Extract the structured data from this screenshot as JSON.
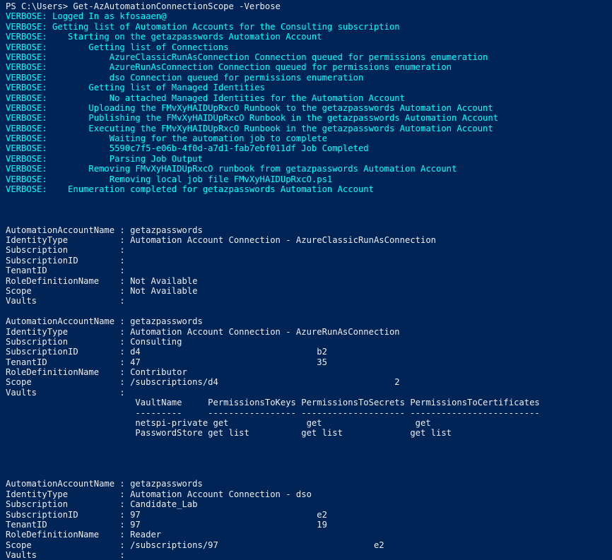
{
  "colors": {
    "background": "#012456",
    "text": "#eeedf0",
    "verbose": "#00ffff"
  },
  "prompt": "PS C:\\Users> Get-AzAutomationConnectionScope -Verbose",
  "verbose_lines": [
    "VERBOSE: Logged In as kfosaaen@",
    "VERBOSE: Getting list of Automation Accounts for the Consulting subscription",
    "VERBOSE:    Starting on the getazpasswords Automation Account",
    "VERBOSE:        Getting list of Connections",
    "VERBOSE:            AzureClassicRunAsConnection Connection queued for permissions enumeration",
    "VERBOSE:            AzureRunAsConnection Connection queued for permissions enumeration",
    "VERBOSE:            dso Connection queued for permissions enumeration",
    "VERBOSE:        Getting list of Managed Identities",
    "VERBOSE:            No attached Managed Identities for the Automation Account",
    "VERBOSE:        Uploading the FMvXyHAIDUpRxcO Runbook to the getazpasswords Automation Account",
    "VERBOSE:        Publishing the FMvXyHAIDUpRxcO Runbook in the getazpasswords Automation Account",
    "VERBOSE:        Executing the FMvXyHAIDUpRxcO Runbook in the getazpasswords Automation Account",
    "VERBOSE:            Waiting for the automation job to complete",
    "VERBOSE:            5590c7f5-e06b-4f0d-a7d1-fab7ebf011df Job Completed",
    "VERBOSE:            Parsing Job Output",
    "VERBOSE:        Removing FMvXyHAIDUpRxcO runbook from getazpasswords Automation Account",
    "VERBOSE:            Removing local job file FMvXyHAIDUpRxcO.ps1",
    "VERBOSE:    Enumeration completed for getazpasswords Automation Account"
  ],
  "output_blocks": [
    {
      "lines": [
        "AutomationAccountName : getazpasswords",
        "IdentityType          : Automation Account Connection - AzureClassicRunAsConnection",
        "Subscription          :",
        "SubscriptionID        :",
        "TenantID              :",
        "RoleDefinitionName    : Not Available",
        "Scope                 : Not Available",
        "Vaults                :"
      ]
    },
    {
      "lines": [
        "AutomationAccountName : getazpasswords",
        "IdentityType          : Automation Account Connection - AzureRunAsConnection",
        "Subscription          : Consulting",
        "SubscriptionID        : d4                                  b2",
        "TenantID              : 47                                  35",
        "RoleDefinitionName    : Contributor",
        "Scope                 : /subscriptions/d4                                  2",
        "Vaults                :",
        "                         VaultName     PermissionsToKeys PermissionsToSecrets PermissionsToCertificates",
        "                         ---------     ----------------- -------------------- -------------------------",
        "                         netspi-private get               get                  get",
        "                         PasswordStore get list          get list             get list"
      ]
    },
    {
      "lines": [
        "AutomationAccountName : getazpasswords",
        "IdentityType          : Automation Account Connection - dso",
        "Subscription          : Candidate_Lab",
        "SubscriptionID        : 97                                  e2",
        "TenantID              : 97                                  19",
        "RoleDefinitionName    : Reader",
        "Scope                 : /subscriptions/97                              e2",
        "Vaults                :"
      ]
    }
  ]
}
